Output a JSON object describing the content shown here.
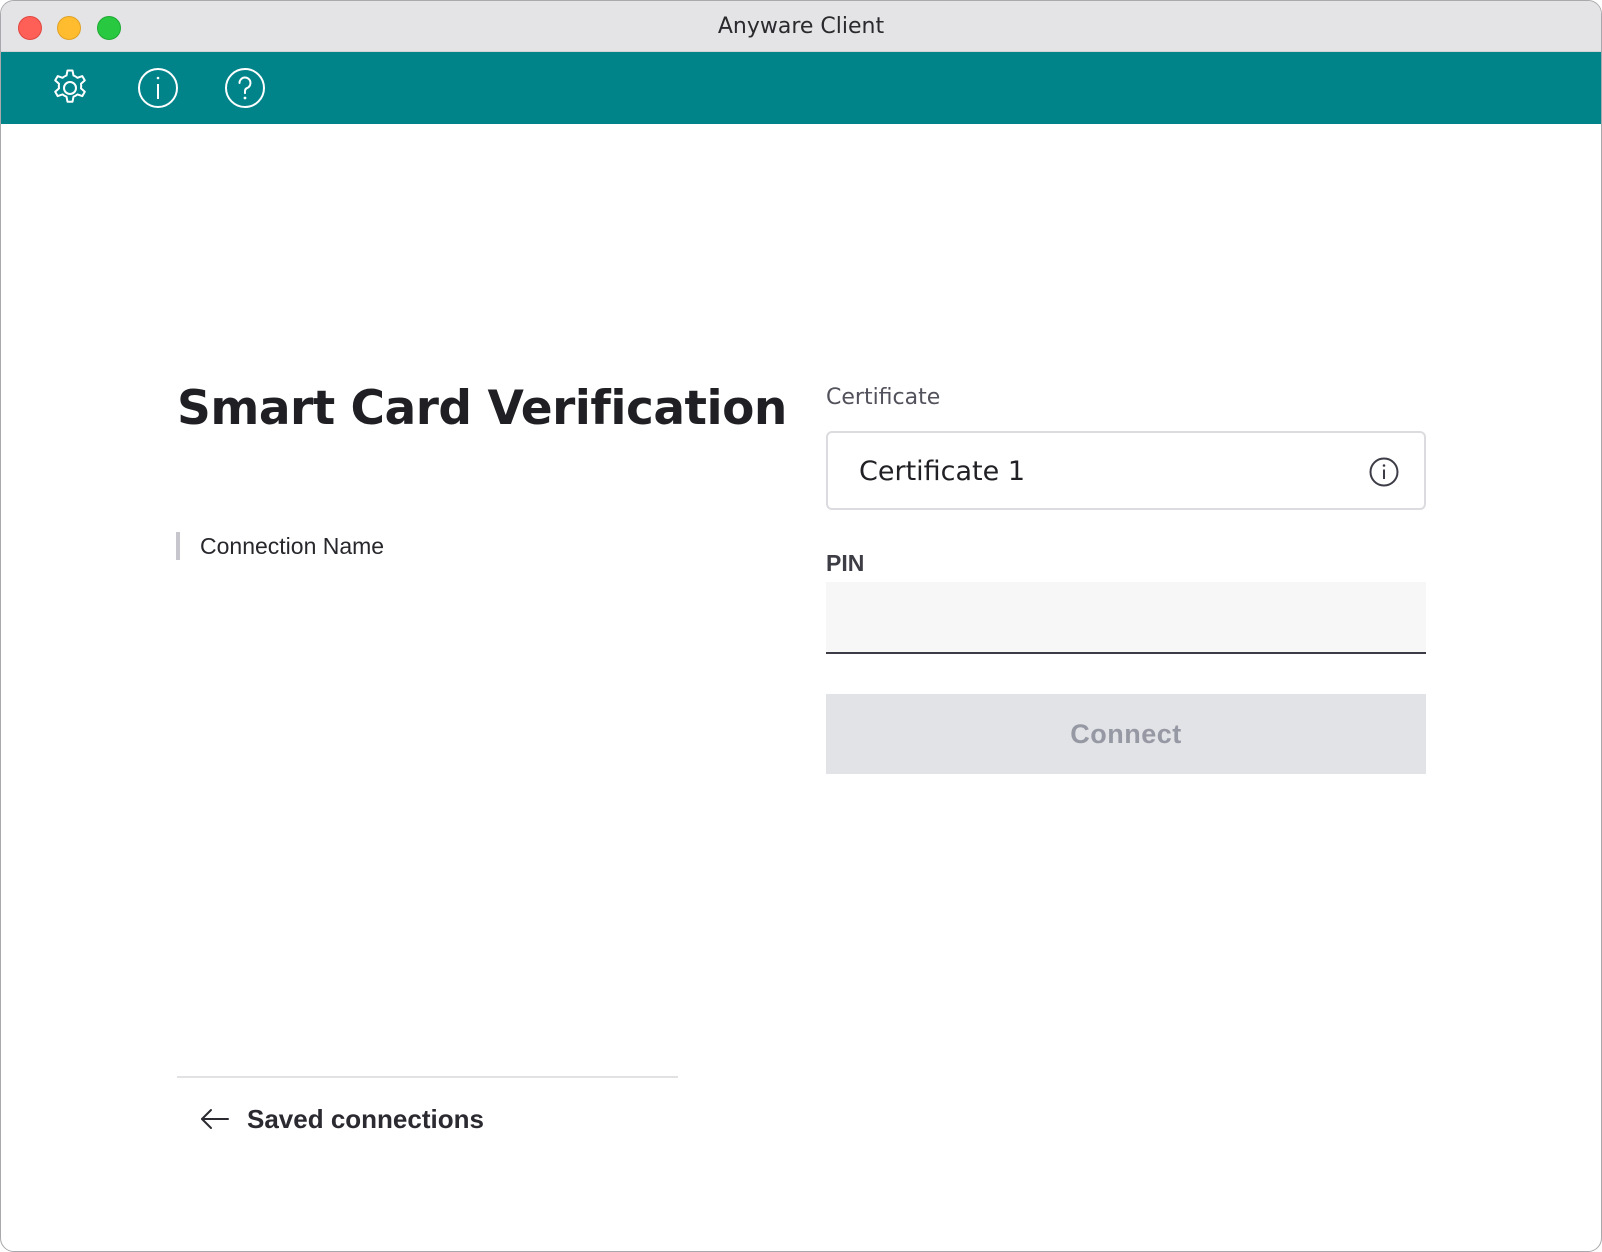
{
  "window": {
    "title": "Anyware Client"
  },
  "toolbar": {
    "icons": [
      "gear-icon",
      "info-icon",
      "help-icon"
    ],
    "color": "#00848a"
  },
  "main": {
    "title": "Smart Card Verification",
    "connection_name": "Connection Name",
    "back_link": "Saved connections"
  },
  "form": {
    "certificate_label": "Certificate",
    "certificate_value": "Certificate 1",
    "pin_label": "PIN",
    "pin_value": "",
    "connect_label": "Connect",
    "connect_enabled": false
  }
}
